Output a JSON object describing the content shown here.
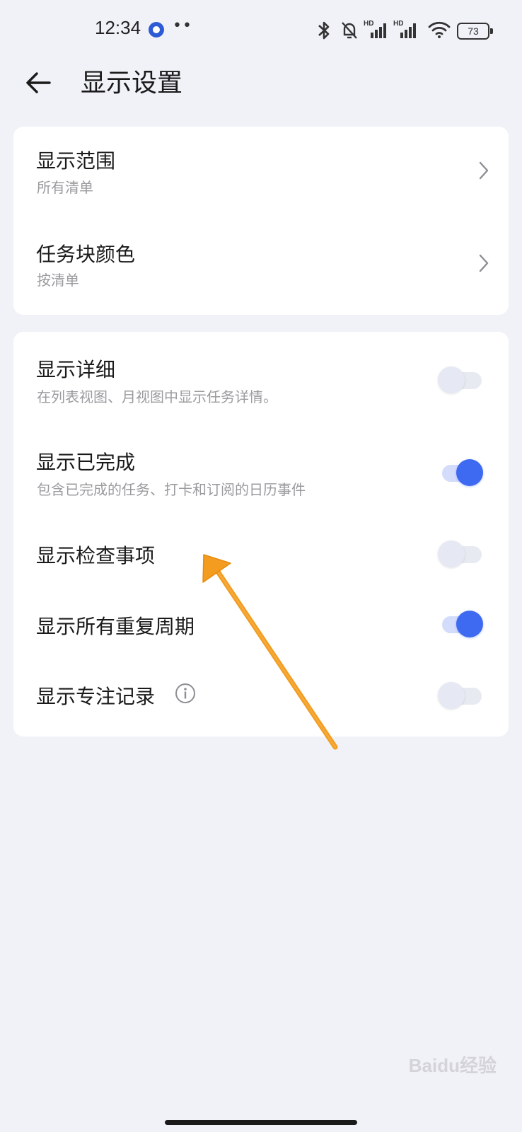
{
  "status_bar": {
    "time": "12:34",
    "battery": "73",
    "icons": [
      "app-badge-icon",
      "more-dots-icon",
      "bluetooth-icon",
      "bell-off-icon",
      "signal-hd-icon",
      "signal-hd-icon",
      "wifi-icon",
      "battery-icon"
    ]
  },
  "header": {
    "title": "显示设置"
  },
  "card1": {
    "items": [
      {
        "title": "显示范围",
        "subtitle": "所有清单"
      },
      {
        "title": "任务块颜色",
        "subtitle": "按清单"
      }
    ]
  },
  "card2": {
    "items": [
      {
        "title": "显示详细",
        "subtitle": "在列表视图、月视图中显示任务详情。",
        "enabled": false
      },
      {
        "title": "显示已完成",
        "subtitle": "包含已完成的任务、打卡和订阅的日历事件",
        "enabled": true
      },
      {
        "title": "显示检查事项",
        "enabled": false
      },
      {
        "title": "显示所有重复周期",
        "enabled": true
      },
      {
        "title": "显示专注记录",
        "enabled": false
      }
    ]
  },
  "colors": {
    "accent": "#3d6af0",
    "background": "#f1f2f8",
    "annotation_arrow": "#f39c1f"
  },
  "watermark": "Baidu经验"
}
